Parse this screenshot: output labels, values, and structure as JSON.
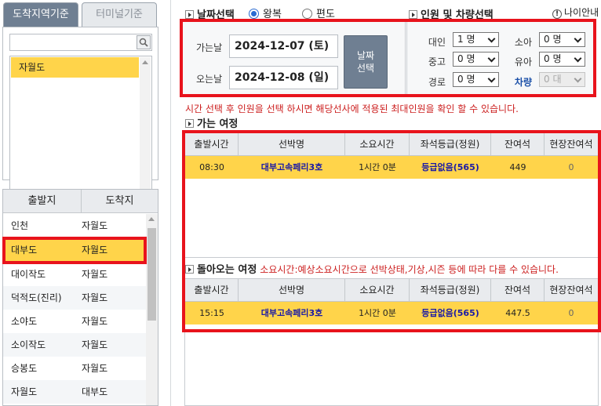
{
  "left": {
    "tabs": [
      {
        "label": "도착지역기준"
      },
      {
        "label": "터미널기준"
      }
    ],
    "search": {
      "value": "",
      "placeholder": ""
    },
    "destinations": [
      "자월도"
    ],
    "route_headers": [
      "출발지",
      "도착지"
    ],
    "routes": [
      {
        "from": "인천",
        "to": "자월도"
      },
      {
        "from": "대부도",
        "to": "자월도"
      },
      {
        "from": "대이작도",
        "to": "자월도"
      },
      {
        "from": "덕적도(진리)",
        "to": "자월도"
      },
      {
        "from": "소야도",
        "to": "자월도"
      },
      {
        "from": "소이작도",
        "to": "자월도"
      },
      {
        "from": "승봉도",
        "to": "자월도"
      },
      {
        "from": "자월도",
        "to": "대부도"
      }
    ]
  },
  "date_section": {
    "title": "날짜선택",
    "trip_options": [
      "왕복",
      "편도"
    ],
    "selected_trip": "왕복",
    "depart_label": "가는날",
    "depart_value": "2024-12-07 (토)",
    "return_label": "오는날",
    "return_value": "2024-12-08 (일)",
    "select_button": "날짜\n선택",
    "select_button_l1": "날짜",
    "select_button_l2": "선택"
  },
  "pax_section": {
    "title": "인원 및 차량선택",
    "help_label": "나이안내",
    "help_icon_text": "!",
    "fields": [
      {
        "label": "대인",
        "value": "1 명"
      },
      {
        "label": "소아",
        "value": "0 명"
      },
      {
        "label": "중고",
        "value": "0 명"
      },
      {
        "label": "유아",
        "value": "0 명"
      },
      {
        "label": "경로",
        "value": "0 명"
      },
      {
        "label": "차량",
        "value": "0 대"
      }
    ]
  },
  "notice": "시간 선택 후 인원을 선택 하시면 해당선사에 적용된 최대인원을 확인 할 수 있습니다.",
  "outbound": {
    "title": "가는 여정",
    "headers": [
      "출발시간",
      "선박명",
      "소요시간",
      "좌석등급(정원)",
      "잔여석",
      "현장잔여석"
    ],
    "rows": [
      {
        "time": "08:30",
        "ship": "대부고속페리3호",
        "duration": "1시간 0분",
        "grade": "등급없음(565)",
        "remaining": "449",
        "onsite": "0"
      }
    ]
  },
  "inbound": {
    "title": "돌아오는 여정",
    "note": "소요시간:예상소요시간으로 선박상태,기상,시즌 등에 따라 다를 수 있습니다.",
    "headers": [
      "출발시간",
      "선박명",
      "소요시간",
      "좌석등급(정원)",
      "잔여석",
      "현장잔여석"
    ],
    "rows": [
      {
        "time": "15:15",
        "ship": "대부고속페리3호",
        "duration": "1시간 0분",
        "grade": "등급없음(565)",
        "remaining": "447.5",
        "onsite": "0"
      }
    ]
  },
  "colors": {
    "highlight": "#ffd44a",
    "accent_tab": "#6f7f92",
    "annotation_red": "#e8131c",
    "notice_red": "#cc1f1f",
    "link_blue": "#1a1aa6"
  }
}
